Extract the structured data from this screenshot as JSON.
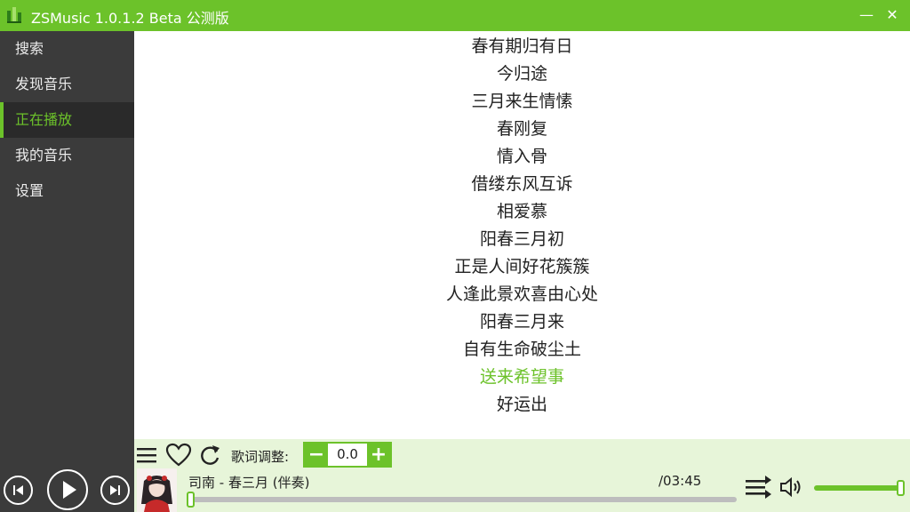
{
  "app": {
    "title": "ZSMusic  1.0.1.2  Beta 公测版",
    "accent_color": "#6cc22a",
    "sidebar_color": "#3b3b3b"
  },
  "window_controls": {
    "minimize": "—",
    "close": "✕"
  },
  "sidebar": {
    "items": [
      {
        "label": "搜索",
        "active": false
      },
      {
        "label": "发现音乐",
        "active": false
      },
      {
        "label": "正在播放",
        "active": true
      },
      {
        "label": "我的音乐",
        "active": false
      },
      {
        "label": "设置",
        "active": false
      }
    ]
  },
  "lyrics": {
    "lines": [
      "春有期归有日",
      "今归途",
      "三月来生情愫",
      "春刚复",
      "情入骨",
      "借缕东风互诉",
      "相爱慕",
      "阳春三月初",
      "正是人间好花簇簇",
      "人逢此景欢喜由心处",
      "阳春三月来",
      "自有生命破尘土",
      "送来希望事",
      "好运出"
    ],
    "current_index": 12
  },
  "player": {
    "lyric_adjust_label": "歌词调整:",
    "lyric_offset": "0.0",
    "minus": "−",
    "plus": "+",
    "song": "司南 - 春三月 (伴奏)",
    "duration": "/03:45",
    "progress": 0.0,
    "volume": 1.0
  }
}
